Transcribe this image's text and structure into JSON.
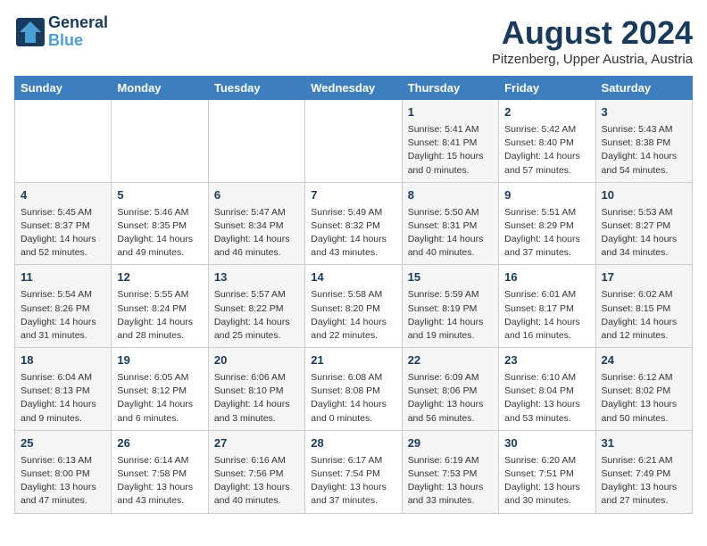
{
  "header": {
    "logo_line1": "General",
    "logo_line2": "Blue",
    "month_year": "August 2024",
    "location": "Pitzenberg, Upper Austria, Austria"
  },
  "weekdays": [
    "Sunday",
    "Monday",
    "Tuesday",
    "Wednesday",
    "Thursday",
    "Friday",
    "Saturday"
  ],
  "weeks": [
    [
      {
        "day": "",
        "info": ""
      },
      {
        "day": "",
        "info": ""
      },
      {
        "day": "",
        "info": ""
      },
      {
        "day": "",
        "info": ""
      },
      {
        "day": "1",
        "info": "Sunrise: 5:41 AM\nSunset: 8:41 PM\nDaylight: 15 hours\nand 0 minutes."
      },
      {
        "day": "2",
        "info": "Sunrise: 5:42 AM\nSunset: 8:40 PM\nDaylight: 14 hours\nand 57 minutes."
      },
      {
        "day": "3",
        "info": "Sunrise: 5:43 AM\nSunset: 8:38 PM\nDaylight: 14 hours\nand 54 minutes."
      }
    ],
    [
      {
        "day": "4",
        "info": "Sunrise: 5:45 AM\nSunset: 8:37 PM\nDaylight: 14 hours\nand 52 minutes."
      },
      {
        "day": "5",
        "info": "Sunrise: 5:46 AM\nSunset: 8:35 PM\nDaylight: 14 hours\nand 49 minutes."
      },
      {
        "day": "6",
        "info": "Sunrise: 5:47 AM\nSunset: 8:34 PM\nDaylight: 14 hours\nand 46 minutes."
      },
      {
        "day": "7",
        "info": "Sunrise: 5:49 AM\nSunset: 8:32 PM\nDaylight: 14 hours\nand 43 minutes."
      },
      {
        "day": "8",
        "info": "Sunrise: 5:50 AM\nSunset: 8:31 PM\nDaylight: 14 hours\nand 40 minutes."
      },
      {
        "day": "9",
        "info": "Sunrise: 5:51 AM\nSunset: 8:29 PM\nDaylight: 14 hours\nand 37 minutes."
      },
      {
        "day": "10",
        "info": "Sunrise: 5:53 AM\nSunset: 8:27 PM\nDaylight: 14 hours\nand 34 minutes."
      }
    ],
    [
      {
        "day": "11",
        "info": "Sunrise: 5:54 AM\nSunset: 8:26 PM\nDaylight: 14 hours\nand 31 minutes."
      },
      {
        "day": "12",
        "info": "Sunrise: 5:55 AM\nSunset: 8:24 PM\nDaylight: 14 hours\nand 28 minutes."
      },
      {
        "day": "13",
        "info": "Sunrise: 5:57 AM\nSunset: 8:22 PM\nDaylight: 14 hours\nand 25 minutes."
      },
      {
        "day": "14",
        "info": "Sunrise: 5:58 AM\nSunset: 8:20 PM\nDaylight: 14 hours\nand 22 minutes."
      },
      {
        "day": "15",
        "info": "Sunrise: 5:59 AM\nSunset: 8:19 PM\nDaylight: 14 hours\nand 19 minutes."
      },
      {
        "day": "16",
        "info": "Sunrise: 6:01 AM\nSunset: 8:17 PM\nDaylight: 14 hours\nand 16 minutes."
      },
      {
        "day": "17",
        "info": "Sunrise: 6:02 AM\nSunset: 8:15 PM\nDaylight: 14 hours\nand 12 minutes."
      }
    ],
    [
      {
        "day": "18",
        "info": "Sunrise: 6:04 AM\nSunset: 8:13 PM\nDaylight: 14 hours\nand 9 minutes."
      },
      {
        "day": "19",
        "info": "Sunrise: 6:05 AM\nSunset: 8:12 PM\nDaylight: 14 hours\nand 6 minutes."
      },
      {
        "day": "20",
        "info": "Sunrise: 6:06 AM\nSunset: 8:10 PM\nDaylight: 14 hours\nand 3 minutes."
      },
      {
        "day": "21",
        "info": "Sunrise: 6:08 AM\nSunset: 8:08 PM\nDaylight: 14 hours\nand 0 minutes."
      },
      {
        "day": "22",
        "info": "Sunrise: 6:09 AM\nSunset: 8:06 PM\nDaylight: 13 hours\nand 56 minutes."
      },
      {
        "day": "23",
        "info": "Sunrise: 6:10 AM\nSunset: 8:04 PM\nDaylight: 13 hours\nand 53 minutes."
      },
      {
        "day": "24",
        "info": "Sunrise: 6:12 AM\nSunset: 8:02 PM\nDaylight: 13 hours\nand 50 minutes."
      }
    ],
    [
      {
        "day": "25",
        "info": "Sunrise: 6:13 AM\nSunset: 8:00 PM\nDaylight: 13 hours\nand 47 minutes."
      },
      {
        "day": "26",
        "info": "Sunrise: 6:14 AM\nSunset: 7:58 PM\nDaylight: 13 hours\nand 43 minutes."
      },
      {
        "day": "27",
        "info": "Sunrise: 6:16 AM\nSunset: 7:56 PM\nDaylight: 13 hours\nand 40 minutes."
      },
      {
        "day": "28",
        "info": "Sunrise: 6:17 AM\nSunset: 7:54 PM\nDaylight: 13 hours\nand 37 minutes."
      },
      {
        "day": "29",
        "info": "Sunrise: 6:19 AM\nSunset: 7:53 PM\nDaylight: 13 hours\nand 33 minutes."
      },
      {
        "day": "30",
        "info": "Sunrise: 6:20 AM\nSunset: 7:51 PM\nDaylight: 13 hours\nand 30 minutes."
      },
      {
        "day": "31",
        "info": "Sunrise: 6:21 AM\nSunset: 7:49 PM\nDaylight: 13 hours\nand 27 minutes."
      }
    ]
  ]
}
